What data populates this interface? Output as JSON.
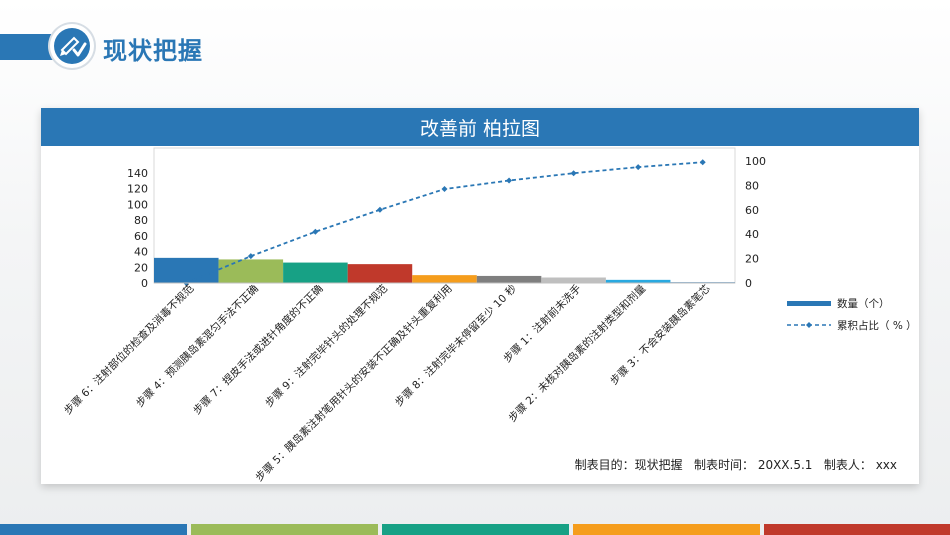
{
  "header": {
    "title": "现状把握"
  },
  "card": {
    "title": "改善前 柏拉图",
    "footer": "制表目的：现状把握   制表时间： 20XX.5.1   制表人： xxx"
  },
  "colors": {
    "primary": "#2a77b5",
    "stripes": [
      "#2a77b5",
      "#9bbb59",
      "#17a185",
      "#f59d1c",
      "#c0392b"
    ]
  },
  "chart_data": {
    "type": "bar",
    "title": "",
    "categories": [
      "步骤 6：注射部位的检查及消毒不规范",
      "步骤 4：预测胰岛素混匀手法不正确",
      "步骤 7：捏皮手法或进针角度的不正确",
      "步骤 9：注射完毕针头的处理不规范",
      "步骤 5：胰岛素注射笔用针头的安装不正确及针头重复利用",
      "步骤 8：注射完毕未停留至少 10 秒",
      "步骤 1：注射前未洗手",
      "步骤 2：未核对胰岛素的注射类型和剂量",
      "步骤 3：不会安装胰岛素笔芯"
    ],
    "series": [
      {
        "name": "数量（个）",
        "type": "bar",
        "axis": "left",
        "colors": [
          "#2a77b5",
          "#9bbb59",
          "#17a185",
          "#c0392b",
          "#f59d1c",
          "#7f7f7f",
          "#bfbfbf",
          "#29a9e0",
          "#2a77b5"
        ],
        "values": [
          32,
          30,
          26,
          24,
          10,
          9,
          7,
          4,
          1
        ]
      },
      {
        "name": "累积占比（ % ）",
        "type": "line",
        "axis": "right",
        "color": "#2a77b5",
        "values": [
          0,
          22,
          42,
          60,
          77,
          84,
          90,
          95,
          99
        ]
      }
    ],
    "y_left": {
      "ylim": [
        0,
        140
      ],
      "ticks": [
        "0",
        "20",
        "40",
        "60",
        "80",
        "100",
        "120",
        "140"
      ]
    },
    "y_right": {
      "ylim": [
        0,
        100
      ],
      "ticks": [
        "0",
        "20",
        "40",
        "60",
        "80",
        "100"
      ]
    },
    "grid": false,
    "legend": "right"
  }
}
